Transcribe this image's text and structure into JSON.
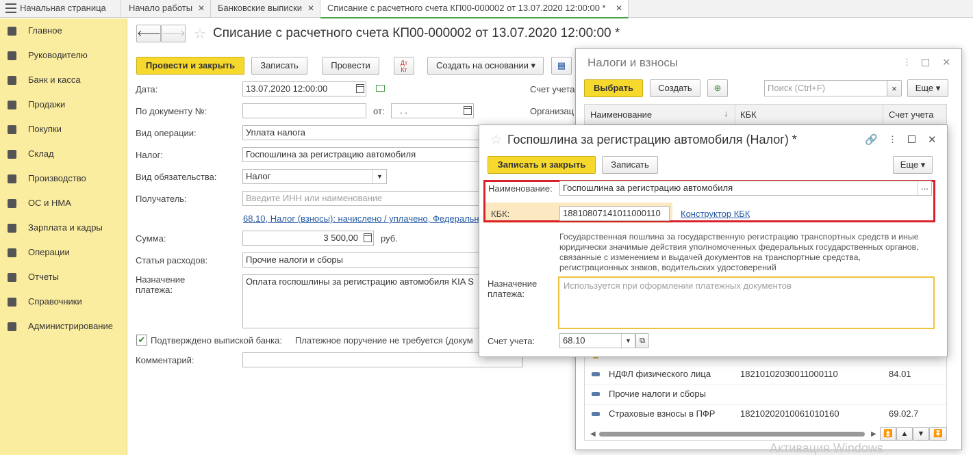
{
  "tabs": {
    "home": "Начальная страница",
    "start": "Начало работы",
    "bank": "Банковские выписки",
    "doc": "Списание с расчетного счета КП00-000002 от 13.07.2020 12:00:00 *"
  },
  "sidebar": {
    "items": [
      "Главное",
      "Руководителю",
      "Банк и касса",
      "Продажи",
      "Покупки",
      "Склад",
      "Производство",
      "ОС и НМА",
      "Зарплата и кадры",
      "Операции",
      "Отчеты",
      "Справочники",
      "Администрирование"
    ]
  },
  "document": {
    "title": "Списание с расчетного счета КП00-000002 от 13.07.2020 12:00:00 *",
    "buttons": {
      "post_close": "Провести и закрыть",
      "save": "Записать",
      "post": "Провести",
      "create_based": "Создать на основании"
    },
    "labels": {
      "date": "Дата:",
      "doc_num": "По документу №:",
      "from": "от:",
      "op_type": "Вид операции:",
      "tax": "Налог:",
      "liability": "Вид обязательства:",
      "recipient": "Получатель:",
      "sum": "Сумма:",
      "expense": "Статья расходов:",
      "purpose": "Назначение платежа:",
      "confirmed": "Подтверждено выпиской банка:",
      "comment": "Комментарий:",
      "account": "Счет учета",
      "org": "Организац"
    },
    "values": {
      "date": "13.07.2020 12:00:00",
      "doc_num": "",
      "from_date": ". .",
      "op_type": "Уплата налога",
      "tax": "Госпошлина за регистрацию автомобиля",
      "liability": "Налог",
      "recipient_placeholder": "Введите ИНН или наименование",
      "account_link": "68.10, Налог (взносы): начислено / уплачено, Федеральн",
      "sum": "3 500,00",
      "currency": "руб.",
      "expense": "Прочие налоги и сборы",
      "purpose": "Оплата госпошлины за регистрацию автомобиля KIA S",
      "payment_order": "Платежное поручение не требуется (докум",
      "comment": ""
    }
  },
  "taxes_window": {
    "title": "Налоги и взносы",
    "buttons": {
      "select": "Выбрать",
      "create": "Создать",
      "more": "Еще"
    },
    "search_placeholder": "Поиск (Ctrl+F)",
    "columns": [
      "Наименование",
      "КБК",
      "Счет учета"
    ],
    "rows": [
      {
        "name": "НДФЛ физического лица",
        "kbk": "18210102030011000110",
        "account": "84.01"
      },
      {
        "name": "Прочие налоги и сборы",
        "kbk": "",
        "account": ""
      },
      {
        "name": "Страховые взносы в ПФР",
        "kbk": "18210202010061010160",
        "account": "69.02.7"
      }
    ]
  },
  "tax_form": {
    "title": "Госпошлина за регистрацию автомобиля (Налог) *",
    "buttons": {
      "save_close": "Записать и закрыть",
      "save": "Записать",
      "more": "Еще"
    },
    "labels": {
      "name": "Наименование:",
      "kbk": "КБК:",
      "purpose": "Назначение платежа:",
      "account": "Счет учета:"
    },
    "values": {
      "name": "Госпошлина за регистрацию автомобиля",
      "kbk": "18810807141011000110",
      "kbk_link": "Конструктор КБК",
      "description": "Государственная пошлина за государственную регистрацию транспортных средств и иные юридически значимые действия уполномоченных федеральных государственных органов, связанные с изменением и выдачей документов на транспортные средства, регистрационных знаков, водительских удостоверений",
      "purpose_placeholder": "Используется при оформлении платежных документов",
      "account": "68.10"
    }
  },
  "watermark": "Активация Windows",
  "colors": {
    "sidebar": "#fbeda0",
    "accent_yellow": "#f7d92e",
    "highlight_red": "#d9212b",
    "link": "#2559a5"
  }
}
